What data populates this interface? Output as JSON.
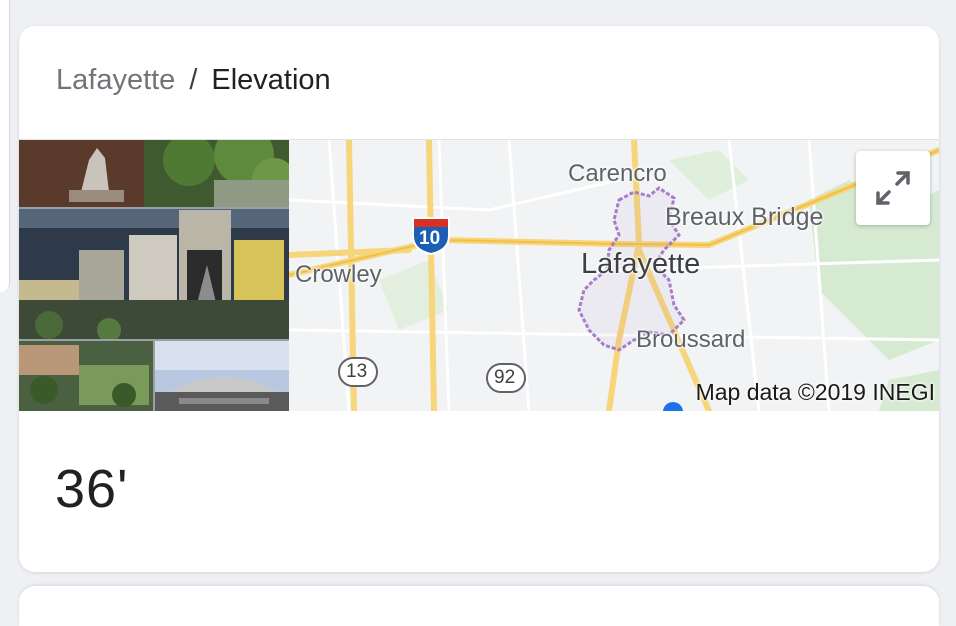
{
  "breadcrumb": {
    "place": "Lafayette",
    "separator": "/",
    "topic": "Elevation"
  },
  "map": {
    "attribution": "Map data ©2019 INEGI",
    "labels": {
      "city_main": "Lafayette",
      "carencro": "Carencro",
      "breaux_bridge": "Breaux Bridge",
      "crowley": "Crowley",
      "broussard": "Broussard"
    },
    "shields": {
      "interstate": "10",
      "route_a": "13",
      "route_b": "92"
    },
    "expand_icon": "expand-icon"
  },
  "elevation": {
    "value": "36'"
  },
  "colors": {
    "interstate_blue": "#1a5fb4",
    "interstate_red": "#d93025",
    "boundary": "#a77cc9",
    "highway": "#f7d57a"
  }
}
